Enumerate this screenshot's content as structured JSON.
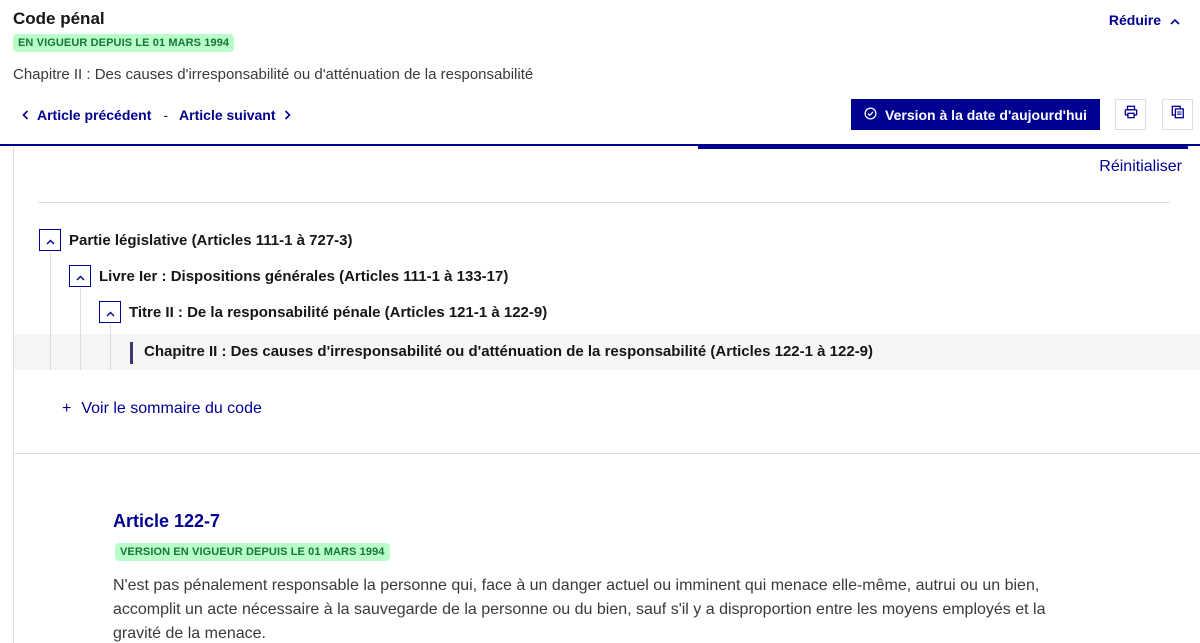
{
  "header": {
    "code_title": "Code pénal",
    "status_badge": "EN VIGUEUR DEPUIS LE 01 MARS 1994",
    "reduce_label": "Réduire",
    "chapter_subtitle": "Chapitre II : Des causes d'irresponsabilité ou d'atténuation de la responsabilité",
    "prev_article_label": "Article précédent",
    "separator": "-",
    "next_article_label": "Article suivant",
    "version_button_label": "Version à la date d'aujourd'hui"
  },
  "sommaire": {
    "reset_label": "Réinitialiser",
    "tree": [
      {
        "label": "Partie législative (Articles 111-1 à 727-3)",
        "toggle_icon": "chevron-up-icon"
      },
      {
        "label": "Livre Ier : Dispositions générales (Articles 111-1 à 133-17)",
        "toggle_icon": "chevron-up-icon"
      },
      {
        "label": "Titre II : De la responsabilité pénale (Articles 121-1 à 122-9)",
        "toggle_icon": "chevron-up-icon"
      }
    ],
    "current_item": "Chapitre II : Des causes d'irresponsabilité ou d'atténuation de la responsabilité (Articles 122-1 à 122-9)",
    "view_summary_prefix": "+",
    "view_summary_label": "Voir le sommaire du code"
  },
  "article": {
    "title": "Article 122-7",
    "version_badge": "VERSION EN VIGUEUR DEPUIS LE 01 MARS 1994",
    "text": "N'est pas pénalement responsable la personne qui, face à un danger actuel ou imminent qui menace elle-même, autrui ou un bien, accomplit un acte nécessaire à la sauvegarde de la personne ou du bien, sauf s'il y a disproportion entre les moyens employés et la gravité de la menace."
  },
  "colors": {
    "primary_blue": "#000091",
    "badge_bg": "#b8fec9",
    "badge_text": "#18753c",
    "border": "#dddddd"
  },
  "icons": [
    "chevron-up-icon",
    "chevron-left-icon",
    "chevron-right-icon",
    "check-circle-icon",
    "print-icon",
    "copy-icon",
    "plus-icon"
  ]
}
